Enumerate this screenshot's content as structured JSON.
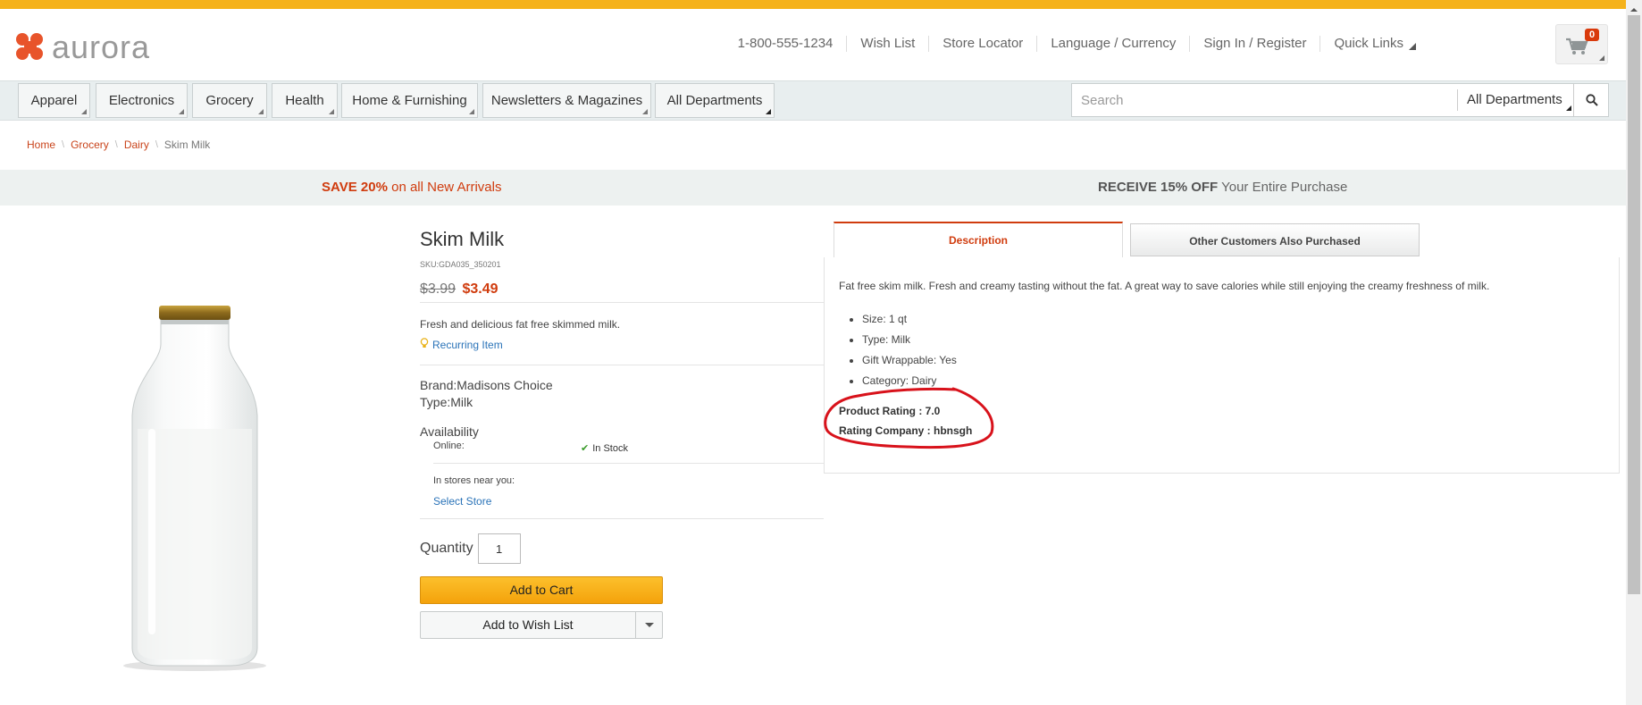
{
  "brand": {
    "logo_text": "aurora"
  },
  "header": {
    "links": [
      "1-800-555-1234",
      "Wish List",
      "Store Locator",
      "Language / Currency",
      "Sign In / Register",
      "Quick Links"
    ],
    "cart_count": "0"
  },
  "nav": {
    "departments": [
      "Apparel",
      "Electronics",
      "Grocery",
      "Health",
      "Home & Furnishing",
      "Newsletters & Magazines",
      "All Departments"
    ],
    "search_placeholder": "Search",
    "search_category": "All Departments"
  },
  "breadcrumb": {
    "items": [
      "Home",
      "Grocery",
      "Dairy"
    ],
    "current": "Skim Milk"
  },
  "promo": {
    "left_bold": "SAVE 20%",
    "left_rest": " on all New Arrivals",
    "right_bold": "RECEIVE 15% OFF",
    "right_rest": " Your Entire Purchase"
  },
  "product": {
    "title": "Skim Milk",
    "sku": "SKU:GDA035_350201",
    "price_old": "$3.99",
    "price_new": "$3.49",
    "short_desc": "Fresh and delicious fat free skimmed milk.",
    "recurring": "Recurring Item",
    "brand": "Brand:Madisons Choice",
    "type": "Type:Milk",
    "availability_heading": "Availability",
    "online_label": "Online:",
    "online_status": "In Stock",
    "stores_label": "In stores near you:",
    "select_store": "Select Store",
    "quantity_label": "Quantity",
    "quantity_value": "1",
    "add_to_cart": "Add to Cart",
    "add_to_wishlist": "Add to Wish List"
  },
  "tabs": {
    "description": "Description",
    "other": "Other Customers Also Purchased"
  },
  "description": {
    "text": "Fat free skim milk. Fresh and creamy tasting without the fat. A great way to save calories while still enjoying the creamy freshness of milk.",
    "attributes": [
      "Size: 1 qt",
      "Type: Milk",
      "Gift Wrappable: Yes",
      "Category: Dairy"
    ],
    "rating": "Product Rating : 7.0",
    "rating_company": "Rating Company : hbnsgh"
  },
  "colors": {
    "accent_orange": "#d03c0e",
    "top_bar": "#f5b21b",
    "link_blue": "#2a73b8",
    "annotation_red": "#d8121b"
  }
}
